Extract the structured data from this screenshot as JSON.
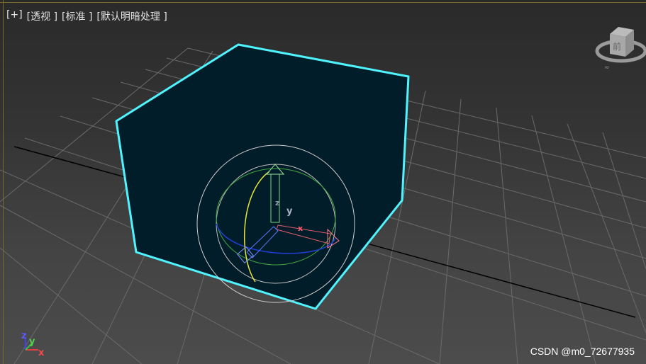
{
  "viewport": {
    "menu": {
      "plus": "[+]",
      "view": "[透视 ]",
      "shading": "[标准 ]",
      "lighting": "[默认明暗处理 ]"
    },
    "viewcube_face": "前",
    "gizmo": {
      "x": "x",
      "y": "y",
      "z": "z"
    },
    "corner_axes": {
      "x": "x",
      "y": "y",
      "z": "z"
    },
    "selection_color": "#4ff4ff"
  },
  "watermark": "CSDN @m0_72677935"
}
